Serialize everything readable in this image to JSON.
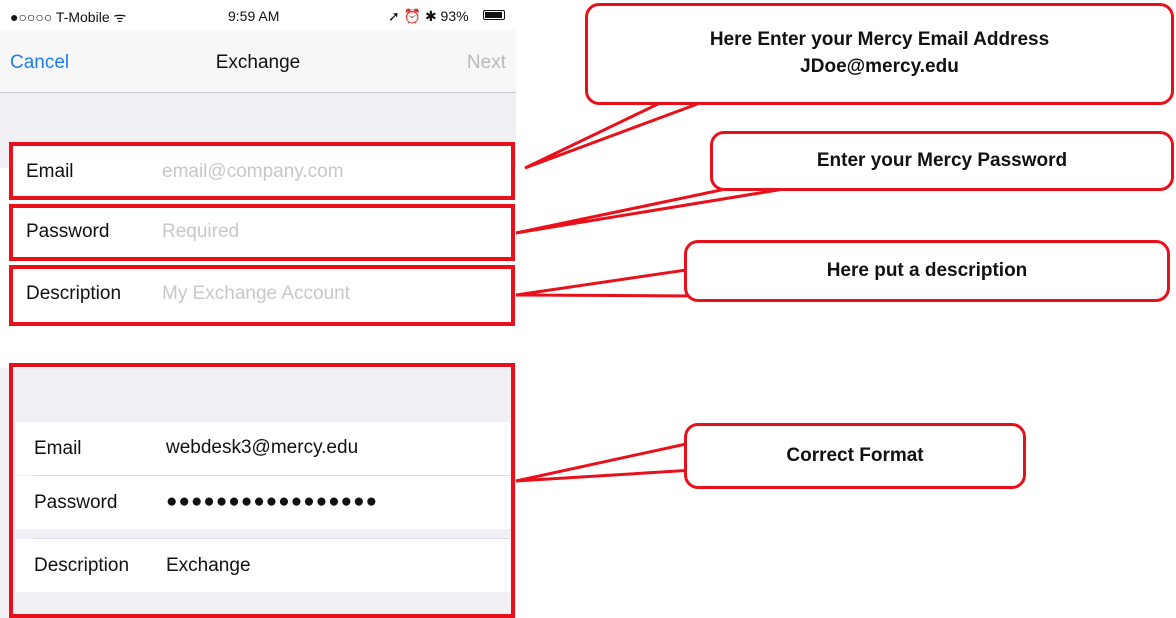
{
  "status_bar": {
    "carrier": "●○○○○ T-Mobile ᯤ",
    "time": "9:59 AM",
    "right": "➚ ⏰ ✱ 93%",
    "battery_level": 0.93
  },
  "nav_bar": {
    "cancel_label": "Cancel",
    "title": "Exchange",
    "next_label": "Next"
  },
  "empty_form": {
    "email": {
      "label": "Email",
      "placeholder": "email@company.com"
    },
    "password": {
      "label": "Password",
      "placeholder": "Required"
    },
    "description": {
      "label": "Description",
      "placeholder": "My Exchange Account"
    }
  },
  "filled_form": {
    "email": {
      "label": "Email",
      "value": "webdesk3@mercy.edu"
    },
    "password": {
      "label": "Password",
      "value": "●●●●●●●●●●●●●●●●●"
    },
    "description": {
      "label": "Description",
      "value": "Exchange"
    }
  },
  "callouts": {
    "email": {
      "line1": "Here Enter your Mercy Email Address",
      "line2": "JDoe@mercy.edu"
    },
    "password": "Enter your Mercy Password",
    "description": "Here put a description",
    "correct_format": "Correct Format"
  },
  "colors": {
    "annotation_red": "#e8111b",
    "ios_blue": "#1b7cf5",
    "placeholder_gray": "#c7c7cc"
  }
}
